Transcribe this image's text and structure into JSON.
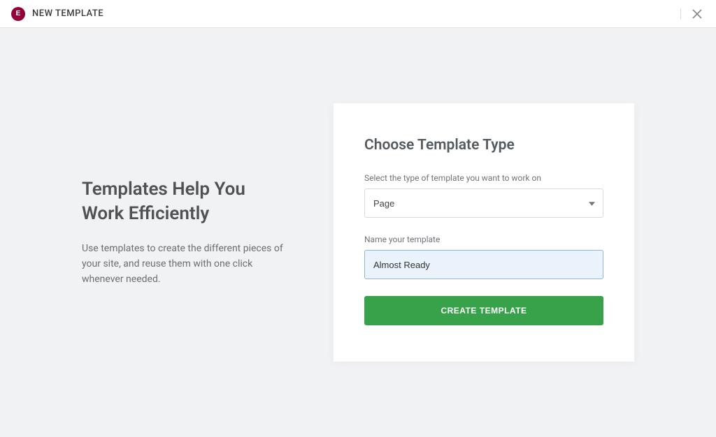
{
  "header": {
    "title": "New Template",
    "logo_text": "E"
  },
  "intro": {
    "heading": "Templates Help You Work Efficiently",
    "subtext": "Use templates to create the different pieces of your site, and reuse them with one click whenever needed."
  },
  "form": {
    "heading": "Choose Template Type",
    "type_label": "Select the type of template you want to work on",
    "type_value": "Page",
    "name_label": "Name your template",
    "name_value": "Almost Ready",
    "submit_label": "Create Template"
  }
}
